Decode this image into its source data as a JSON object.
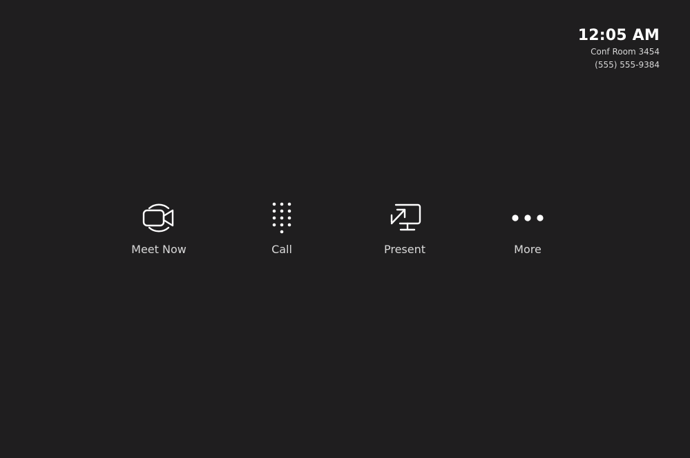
{
  "header": {
    "time": "12:05 AM",
    "room_name": "Conf Room 3454",
    "phone_number": "(555) 555-9384"
  },
  "actions": [
    {
      "label": "Meet Now",
      "icon": "video-camera-icon"
    },
    {
      "label": "Call",
      "icon": "dialpad-icon"
    },
    {
      "label": "Present",
      "icon": "share-screen-icon"
    },
    {
      "label": "More",
      "icon": "more-dots-icon"
    }
  ],
  "colors": {
    "background": "#1f1e1f",
    "text": "#ffffff",
    "secondary_text": "#d6d6d6"
  }
}
